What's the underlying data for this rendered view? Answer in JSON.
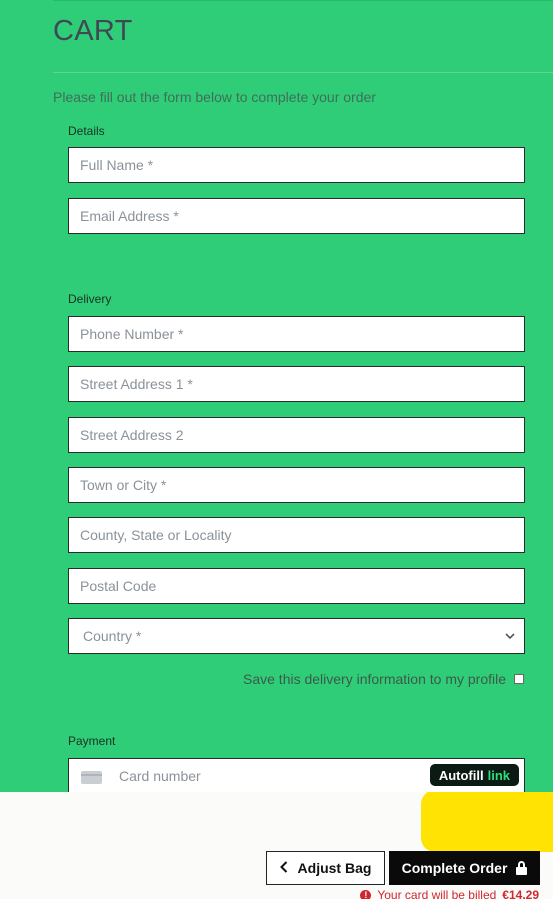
{
  "page": {
    "title": "CART",
    "intro": "Please fill out the form below to complete your order"
  },
  "details": {
    "label": "Details",
    "full_name_placeholder": "Full Name *",
    "email_placeholder": "Email Address *"
  },
  "delivery": {
    "label": "Delivery",
    "phone_placeholder": "Phone Number *",
    "street1_placeholder": "Street Address 1 *",
    "street2_placeholder": "Street Address 2",
    "town_placeholder": "Town or City *",
    "county_placeholder": "County, State or Locality",
    "postal_placeholder": "Postal Code",
    "country_selected": "Country *",
    "save_label": "Save this delivery information to my profile"
  },
  "payment": {
    "label": "Payment",
    "card_placeholder": "Card number",
    "autofill_label": "Autofill",
    "autofill_brand": "link"
  },
  "footer": {
    "adjust_label": "Adjust Bag",
    "complete_label": "Complete Order",
    "billing_notice": "Your card will be billed",
    "billing_amount": "€14.29"
  },
  "colors": {
    "background": "#30cd79",
    "accent_yellow": "#ffe403",
    "error": "#d0272f"
  },
  "icons": [
    "chevron-left-icon",
    "lock-icon",
    "card-icon",
    "alert-icon",
    "chevron-down-icon"
  ]
}
